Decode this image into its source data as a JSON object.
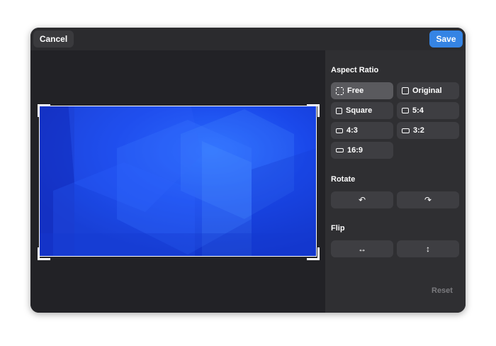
{
  "header": {
    "cancel_label": "Cancel",
    "save_label": "Save"
  },
  "sidebar": {
    "aspect_title": "Aspect Ratio",
    "aspect_options": [
      {
        "label": "Free",
        "icon": "dashed-square-icon",
        "selected": true
      },
      {
        "label": "Original",
        "icon": "square-icon",
        "selected": false
      },
      {
        "label": "Square",
        "icon": "square-icon",
        "selected": false
      },
      {
        "label": "5:4",
        "icon": "rectangle-icon",
        "selected": false
      },
      {
        "label": "4:3",
        "icon": "rectangle-icon",
        "selected": false
      },
      {
        "label": "3:2",
        "icon": "rectangle-icon",
        "selected": false
      },
      {
        "label": "16:9",
        "icon": "wide-rectangle-icon",
        "selected": false
      }
    ],
    "rotate_title": "Rotate",
    "rotate_left_glyph": "↶",
    "rotate_right_glyph": "↷",
    "flip_title": "Flip",
    "flip_horizontal_glyph": "↔",
    "flip_vertical_glyph": "↕",
    "reset_label": "Reset"
  },
  "colors": {
    "accent": "#3584e4",
    "window_bg": "#1e1e21",
    "sidebar_bg": "#2f2f32",
    "button_bg": "#3e3e42",
    "selected_bg": "#5a5a5e",
    "image_blue": "#1a40e0"
  }
}
